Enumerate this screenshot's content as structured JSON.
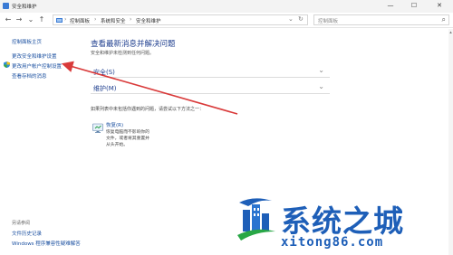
{
  "window": {
    "title": "安全和维护",
    "minimize": "—",
    "maximize": "☐",
    "close": "✕"
  },
  "nav": {
    "back": "←",
    "forward": "→",
    "down": "⌄",
    "up": "↑",
    "refresh": "↻"
  },
  "address": {
    "breadcrumb": [
      "控制面板",
      "系统和安全",
      "安全和维护"
    ],
    "separator": "›",
    "dropdown": "⌄"
  },
  "search": {
    "placeholder": "控制面板"
  },
  "sidebar": {
    "home": "控制面板主页",
    "items": [
      "更改安全和维护设置",
      "更改用户帐户控制设置",
      "查看存档的消息"
    ],
    "see_also": "另请参阅",
    "footer_links": [
      "文件历史记录",
      "Windows 程序兼容性疑难解答"
    ]
  },
  "main": {
    "title": "查看最新消息并解决问题",
    "subtitle": "安全和维护未检测到任何问题。",
    "sections": [
      {
        "label": "安全(S)"
      },
      {
        "label": "维护(M)"
      }
    ],
    "hint": "如果列表中未包括你遇到的问题，请尝试以下方法之一：",
    "troubleshoot": {
      "title": "恢复(R)",
      "desc": [
        "恢复电脑而不影响你的",
        "文件，或者将其重置并",
        "从头开始。"
      ]
    }
  },
  "watermark": {
    "cn": "系统之城",
    "en": "xitong86.com"
  },
  "colors": {
    "accent": "#1e5fb8",
    "link": "#1a4fa0",
    "arrow": "#d93a3a"
  }
}
